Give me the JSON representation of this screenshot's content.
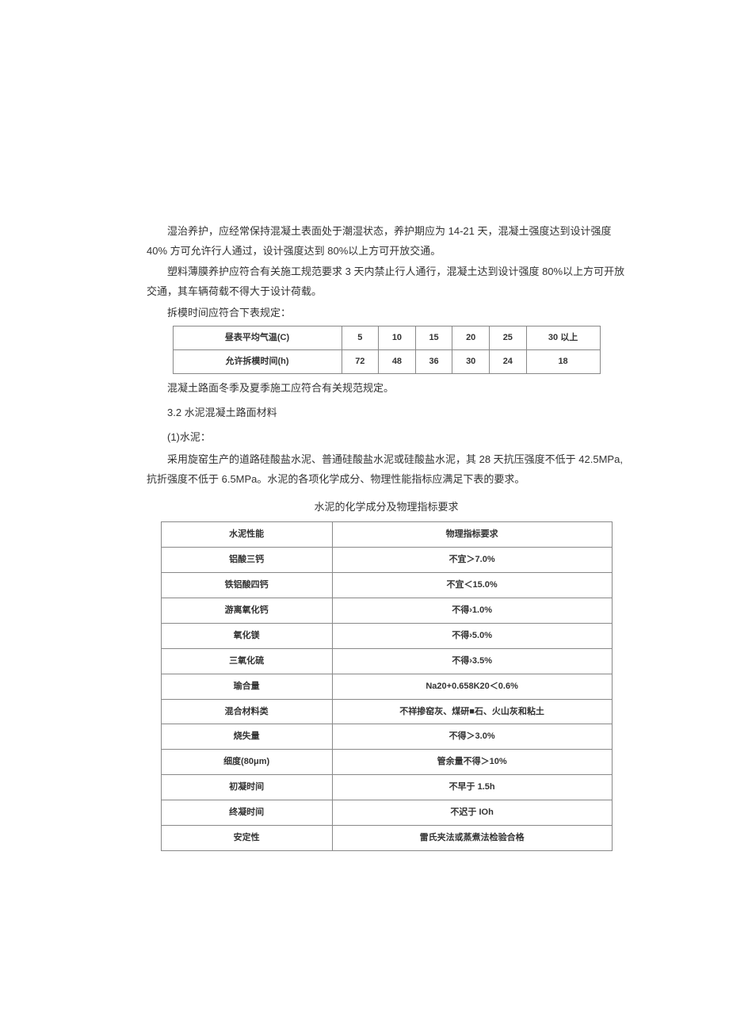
{
  "paragraphs": {
    "p1": "湿治养护，应经常保持混凝土表面处于潮湿状态，养护期应为 14-21 天，混凝土强度达到设计强度 40% 方可允许行人通过，设计强度达到 80%以上方可开放交通。",
    "p2": "塑料薄膜养护应符合有关施工规范要求 3 天内禁止行人通行，混凝土达到设计强度 80%以上方可开放交通，其车辆荷载不得大于设计荷载。",
    "p3": "拆模时间应符合下表规定：",
    "p4": "混凝土路面冬季及夏季施工应符合有关规范规定。",
    "sec32": "3.2 水泥混凝土路面材料",
    "item1": "(1)水泥：",
    "p5": "采用旋窑生产的道路硅酸盐水泥、普通硅酸盐水泥或硅酸盐水泥，其 28 天抗压强度不低于 42.5MPa,抗折强度不低于 6.5MPa。水泥的各项化学成分、物理性能指标应满足下表的要求。",
    "caption2": "水泥的化学成分及物理指标要求"
  },
  "table1": {
    "r1": {
      "c0": "昼表平均气温(C)",
      "c1": "5",
      "c2": "10",
      "c3": "15",
      "c4": "20",
      "c5": "25",
      "c6": "30 以上"
    },
    "r2": {
      "c0": "允许拆模时间(h)",
      "c1": "72",
      "c2": "48",
      "c3": "36",
      "c4": "30",
      "c5": "24",
      "c6": "18"
    }
  },
  "table2": {
    "rows": [
      {
        "a": "水泥性能",
        "b": "物理指标要求"
      },
      {
        "a": "铝酸三钙",
        "b": "不宜＞7.0%"
      },
      {
        "a": "铁铝酸四钙",
        "b": "不宜＜15.0%"
      },
      {
        "a": "游离氧化钙",
        "b": "不得›1.0%"
      },
      {
        "a": "氧化镁",
        "b": "不得›5.0%"
      },
      {
        "a": "三氧化硫",
        "b": "不得›3.5%"
      },
      {
        "a": "瑜合量",
        "b": "Na20+0.658K20＜0.6%"
      },
      {
        "a": "混合材料类",
        "b": "不祥掺窑灰、煤研■石、火山灰和粘土"
      },
      {
        "a": "烧失量",
        "b": "不得＞3.0%"
      },
      {
        "a": "细度(80μm)",
        "b": "管余量不得＞10%"
      },
      {
        "a": "初凝时间",
        "b": "不早于 1.5h"
      },
      {
        "a": "终凝时间",
        "b": "不迟于 IOh"
      },
      {
        "a": "安定性",
        "b": "雷氏夹法或蒸煮法检验合格"
      }
    ]
  }
}
